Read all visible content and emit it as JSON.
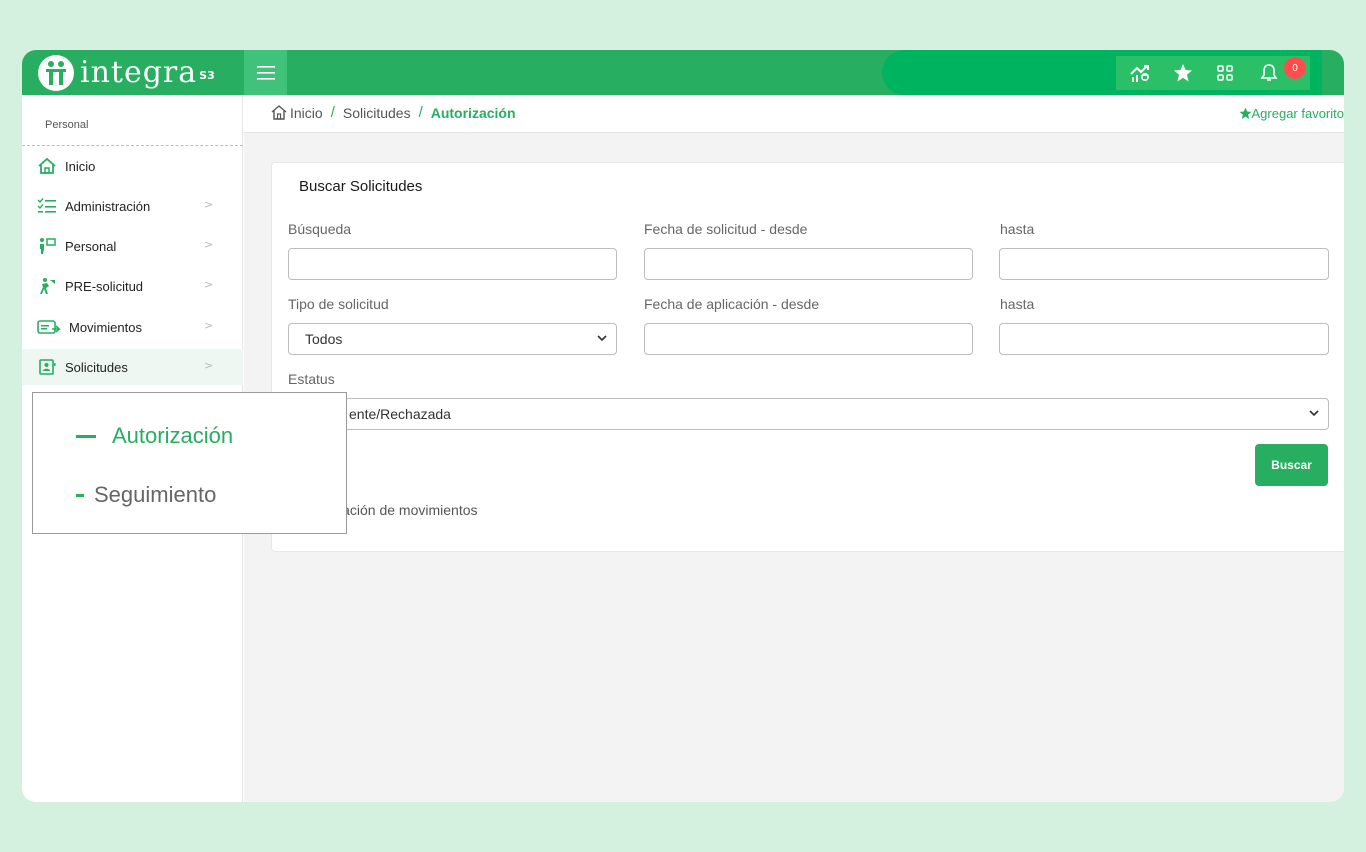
{
  "brand": {
    "name": "integra",
    "suffix": "S3"
  },
  "header": {
    "notifications_count": "0"
  },
  "sidebar": {
    "section": "Personal",
    "items": [
      {
        "label": "Inicio"
      },
      {
        "label": "Administración"
      },
      {
        "label": "Personal"
      },
      {
        "label": "PRE-solicitud"
      },
      {
        "label": "Movimientos"
      },
      {
        "label": "Solicitudes"
      }
    ]
  },
  "breadcrumb": {
    "home": "Inicio",
    "parent": "Solicitudes",
    "current": "Autorización"
  },
  "favorite_label": "Agregar favorito",
  "search_card": {
    "title": "Buscar Solicitudes",
    "label_busqueda": "Búsqueda",
    "label_fecha_solicitud_desde": "Fecha de solicitud - desde",
    "label_hasta_1": "hasta",
    "label_tipo": "Tipo de solicitud",
    "tipo_value": "Todos",
    "label_fecha_aplicacion_desde": "Fecha de aplicación - desde",
    "label_hasta_2": "hasta",
    "label_estatus": "Estatus",
    "estatus_value_visible": "ente/Rechazada",
    "search_button": "Buscar",
    "note_visible": "ización de movimientos"
  },
  "submenu": {
    "items": [
      {
        "label": "Autorización",
        "active": true
      },
      {
        "label": "Seguimiento",
        "active": false
      }
    ]
  },
  "colors": {
    "accent": "#27ae60",
    "badge": "#ff4d4d",
    "background": "#d4f0df"
  }
}
